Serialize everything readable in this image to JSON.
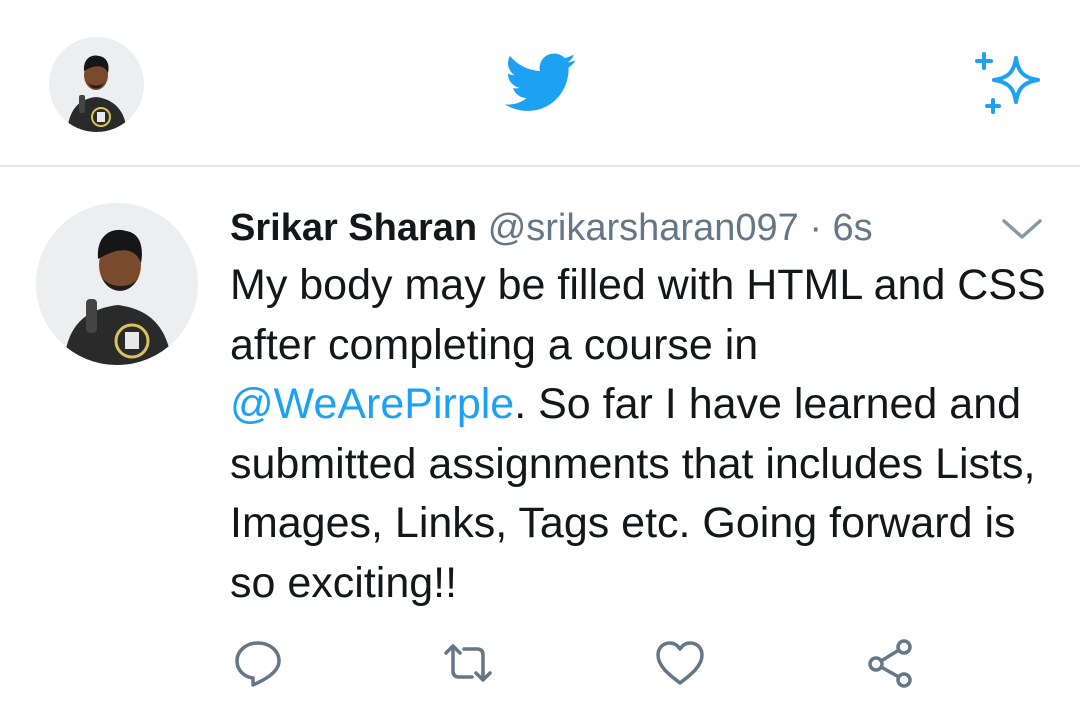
{
  "app": {
    "top_avatar_icon": "user-avatar",
    "logo_icon": "twitter-bird-icon",
    "sparkle_icon": "sparkle-icon",
    "brand_color": "#1da1f2"
  },
  "tweet": {
    "author_name": "Srikar Sharan",
    "author_handle": "@srikarsharan097",
    "separator": "·",
    "time": "6s",
    "text_part1": "My body may be filled with HTML and CSS after completing a course in ",
    "mention": "@WeArePirple",
    "text_part2": ". So far I have learned and submitted assignments that includes Lists, Images, Links, Tags etc. Going forward is so exciting!!",
    "caret_icon": "chevron-down-icon"
  },
  "actions": {
    "reply_icon": "reply-icon",
    "retweet_icon": "retweet-icon",
    "like_icon": "heart-icon",
    "share_icon": "share-icon",
    "icon_color": "#657786"
  }
}
